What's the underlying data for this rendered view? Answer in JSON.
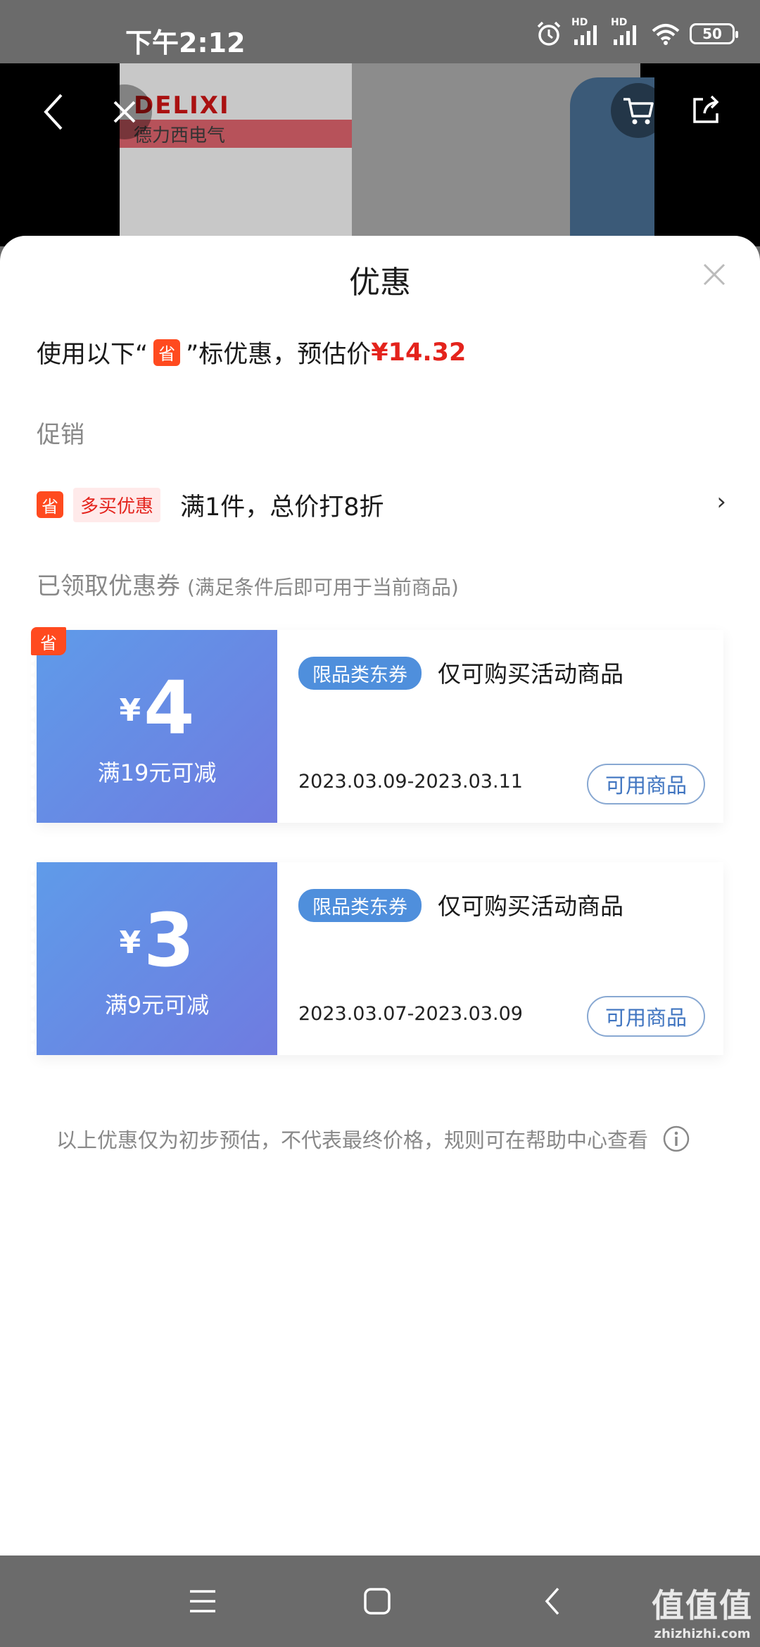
{
  "status_bar": {
    "time": "下午2:12",
    "battery": "50",
    "signal_label_1": "HD",
    "signal_label_2": "HD"
  },
  "product_header": {
    "brand_text": "DELIXI",
    "brand_sub": "德力西电气"
  },
  "sheet": {
    "title": "优惠",
    "summary_prefix": "使用以下“",
    "sheng_tag": "省",
    "summary_middle": "”标优惠，预估价",
    "estimated_price": "¥14.32",
    "promo_section_label": "促销",
    "promo": {
      "icon_text": "省",
      "badge": "多买优惠",
      "text": "满1件，总价打8折",
      "arrow": "›"
    },
    "received_label": "已领取优惠券",
    "received_note": "(满足条件后即可用于当前商品)",
    "coupons": [
      {
        "corner": "省",
        "currency": "¥",
        "amount": "4",
        "condition": "满19元可减",
        "tag": "限品类东券",
        "title": "仅可购买活动商品",
        "dates": "2023.03.09-2023.03.11",
        "button": "可用商品"
      },
      {
        "currency": "¥",
        "amount": "3",
        "condition": "满9元可减",
        "tag": "限品类东券",
        "title": "仅可购买活动商品",
        "dates": "2023.03.07-2023.03.09",
        "button": "可用商品"
      }
    ],
    "footnote": "以上优惠仅为初步预估，不代表最终价格，规则可在帮助中心查看"
  },
  "watermark": {
    "main": "值值值",
    "sub": "zhizhizhi.com"
  },
  "colors": {
    "price_red": "#e4231c",
    "coupon_blue": "#5f9be9",
    "sheng_orange": "#ff4a1f"
  }
}
